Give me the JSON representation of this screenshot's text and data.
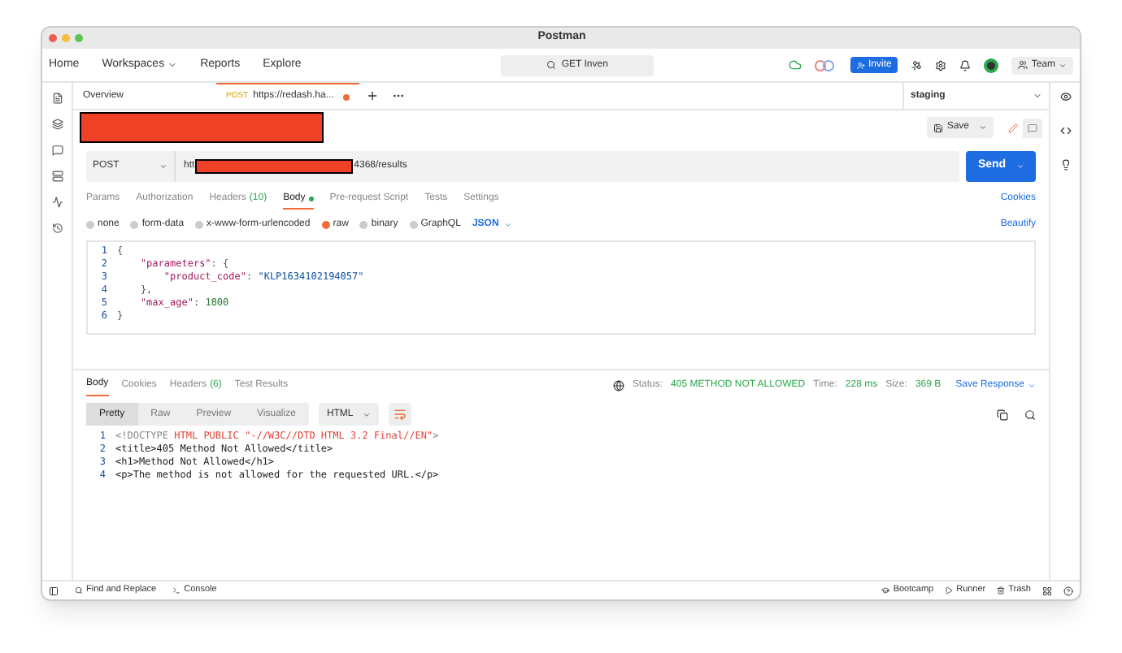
{
  "window": {
    "title": "Postman"
  },
  "menu": [
    {
      "label": "Home",
      "dropdown": false
    },
    {
      "label": "Workspaces",
      "dropdown": true
    },
    {
      "label": "Reports",
      "dropdown": false
    },
    {
      "label": "Explore",
      "dropdown": false
    }
  ],
  "search": {
    "value": "GET Inven"
  },
  "invite": "Invite",
  "team": "Team",
  "tabs": [
    {
      "label": "Overview",
      "selected": false,
      "unsaved": false
    },
    {
      "label": "https://redash.ha...",
      "method": "POST",
      "selected": true,
      "unsaved": true
    }
  ],
  "environment": "staging",
  "save": "Save",
  "request": {
    "method": "POST",
    "url_start": "htt",
    "url_end": "4368/results",
    "send": "Send"
  },
  "request_tabs": [
    {
      "label": "Params",
      "selected": false,
      "dot": false
    },
    {
      "label": "Authorization",
      "selected": false,
      "dot": false
    },
    {
      "label": "Headers",
      "count": "(10)",
      "selected": false,
      "dot": false
    },
    {
      "label": "Body",
      "selected": true,
      "dot": true
    },
    {
      "label": "Pre-request Script",
      "selected": false,
      "dot": false
    },
    {
      "label": "Tests",
      "selected": false,
      "dot": false
    },
    {
      "label": "Settings",
      "selected": false,
      "dot": false
    }
  ],
  "cookies": "Cookies",
  "body_types": [
    {
      "label": "none",
      "selected": false
    },
    {
      "label": "form-data",
      "selected": false
    },
    {
      "label": "x-www-form-urlencoded",
      "selected": false
    },
    {
      "label": "raw",
      "selected": true
    },
    {
      "label": "binary",
      "selected": false
    },
    {
      "label": "GraphQL",
      "selected": false
    }
  ],
  "body_format": "JSON",
  "beautify": "Beautify",
  "editor": [
    {
      "number": "1",
      "tokens": [
        {
          "text": "{",
          "kind": "punct"
        }
      ]
    },
    {
      "number": "2",
      "tokens": [
        {
          "text": "    \"parameters\"",
          "kind": "key"
        },
        {
          "text": ": {",
          "kind": "punct"
        }
      ]
    },
    {
      "number": "3",
      "tokens": [
        {
          "text": "        \"product_code\"",
          "kind": "key"
        },
        {
          "text": ": ",
          "kind": "punct"
        },
        {
          "text": "\"KLP1634102194057\"",
          "kind": "string"
        }
      ]
    },
    {
      "number": "4",
      "tokens": [
        {
          "text": "    },",
          "kind": "punct"
        }
      ]
    },
    {
      "number": "5",
      "tokens": [
        {
          "text": "    \"max_age\"",
          "kind": "key"
        },
        {
          "text": ": ",
          "kind": "punct"
        },
        {
          "text": "1800",
          "kind": "number"
        }
      ]
    },
    {
      "number": "6",
      "tokens": [
        {
          "text": "}",
          "kind": "punct"
        }
      ]
    }
  ],
  "response_tabs": [
    {
      "label": "Body",
      "selected": true
    },
    {
      "label": "Cookies",
      "selected": false
    },
    {
      "label": "Headers",
      "count": "(6)",
      "selected": false
    },
    {
      "label": "Test Results",
      "selected": false
    }
  ],
  "status": {
    "status_label": "Status:",
    "status": "405 METHOD NOT ALLOWED",
    "time_label": "Time:",
    "time": "228 ms",
    "size_label": "Size:",
    "size": "369 B",
    "save_response": "Save Response"
  },
  "view_modes": [
    {
      "label": "Pretty",
      "selected": true
    },
    {
      "label": "Raw",
      "selected": false
    },
    {
      "label": "Preview",
      "selected": false
    },
    {
      "label": "Visualize",
      "selected": false
    }
  ],
  "response_format": "HTML",
  "response": [
    {
      "number": "1",
      "tokens": [
        {
          "text": "<!DOCTYPE",
          "kind": "punct"
        },
        {
          "text": " HTML PUBLIC \"-//W3C//DTD HTML 3.2 Final//EN\"",
          "kind": "string"
        },
        {
          "text": ">",
          "kind": "punct"
        }
      ]
    },
    {
      "number": "2",
      "tokens": [
        {
          "text": "<title>405 Method Not Allowed</title>",
          "kind": "text"
        }
      ]
    },
    {
      "number": "3",
      "tokens": [
        {
          "text": "<h1>Method Not Allowed</h1>",
          "kind": "text"
        }
      ]
    },
    {
      "number": "4",
      "tokens": [
        {
          "text": "<p>The method is not allowed for the requested URL.</p>",
          "kind": "text"
        }
      ]
    }
  ],
  "status_bar": {
    "left": [
      {
        "label": "Find and Replace",
        "kind": "search"
      },
      {
        "label": "Console",
        "kind": "console"
      }
    ],
    "right": [
      {
        "label": "Bootcamp",
        "kind": "bootcamp"
      },
      {
        "label": "Runner",
        "kind": "runner"
      },
      {
        "label": "Trash",
        "kind": "trash"
      }
    ]
  }
}
